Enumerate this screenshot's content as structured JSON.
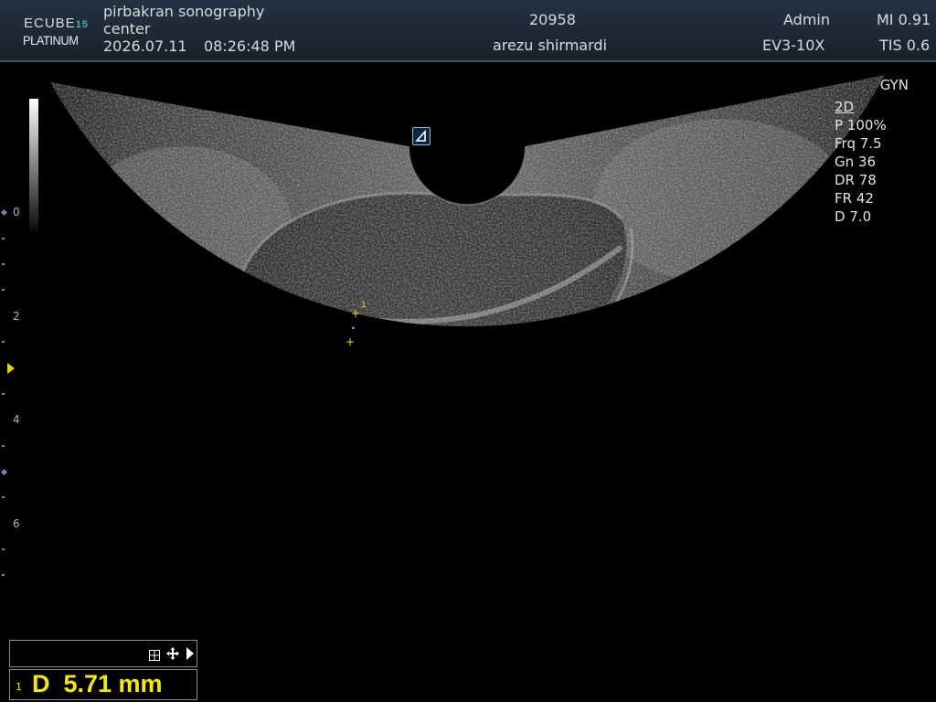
{
  "header": {
    "logo_brand": "ECUBE",
    "logo_model": "15",
    "logo_edition": "PLATINUM",
    "institution_line1": "pirbakran sonography",
    "institution_line2": "center",
    "date": "2026.07.11",
    "time": "08:26:48  PM",
    "patient_id": "20958",
    "patient_name": "arezu shirmardi",
    "operator": "Admin",
    "probe": "EV3-10X",
    "mi": "MI 0.91",
    "tis": "TIS 0.6"
  },
  "preset": "GYN",
  "imaging_params": {
    "mode": "2D",
    "power": "P 100%",
    "frequency": "Frq 7.5",
    "gain": "Gn 36",
    "dynamic_range": "DR 78",
    "frame_rate": "FR 42",
    "depth": "D 7.0"
  },
  "depth_scale": {
    "labels": [
      "0",
      "2",
      "4",
      "6"
    ]
  },
  "caliper": {
    "label": "1",
    "point_marker": "+"
  },
  "measurement": {
    "index": "1",
    "text": "D  5.71 mm"
  },
  "tools": {
    "grid_icon": "grid-icon",
    "move_icon": "move-icon",
    "next_icon": "play-arrow-icon"
  },
  "colors": {
    "caliper": "#f2e600",
    "header_bg": "#1f2a36",
    "accent": "#38b2b5"
  }
}
